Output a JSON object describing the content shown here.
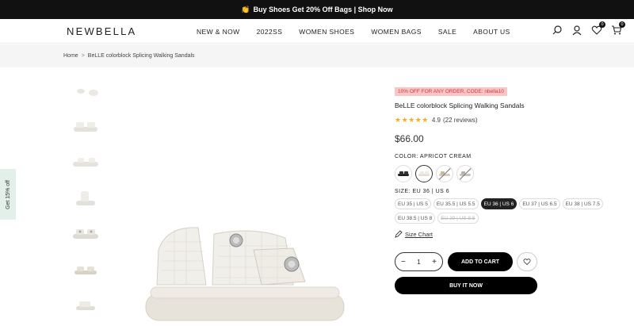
{
  "announcement": {
    "emoji": "👏",
    "text": "Buy Shoes Get 20% Off Bags | Shop Now"
  },
  "header": {
    "logo": "NEWBELLA",
    "nav": [
      "NEW & NOW",
      "2022SS",
      "WOMEN SHOES",
      "WOMEN BAGS",
      "SALE",
      "ABOUT US"
    ],
    "wishlist_count": "0",
    "cart_count": "0"
  },
  "breadcrumb": {
    "home": "Home",
    "separator": ">",
    "current": "BeLLE colorblock Splicing Walking Sandals"
  },
  "side_tab": "Get 15% off",
  "product": {
    "promo": "10% OFF FOR ANY ORDER, CODE: nbella10",
    "title": "BeLLE colorblock Splicing Walking Sandals",
    "stars": "★★★★★",
    "rating": "4.9",
    "reviews": "(22 reviews)",
    "price": "$66.00",
    "color_label": "COLOR:",
    "color_value": "APRICOT CREAM",
    "size_label": "SIZE:",
    "size_value": "EU 36 | US 6",
    "sizes": [
      {
        "label": "EU 35 | US 5",
        "state": "normal"
      },
      {
        "label": "EU 35.5 | US 5.5",
        "state": "normal"
      },
      {
        "label": "EU 36 | US 6",
        "state": "selected"
      },
      {
        "label": "EU 37 | US 6.5",
        "state": "normal"
      },
      {
        "label": "EU 38 | US 7.5",
        "state": "normal"
      },
      {
        "label": "EU 38.5 | US 8",
        "state": "normal"
      },
      {
        "label": "EU 39 | US 8.5",
        "state": "soldout"
      }
    ],
    "size_chart": "Size Chart",
    "quantity": "1",
    "minus": "−",
    "plus": "+",
    "add_to_cart": "ADD TO CART",
    "buy_now": "BUY IT NOW"
  },
  "colors": {
    "accent": "#111111",
    "promo_bg": "#f7c6c6",
    "promo_text": "#dd3333",
    "star": "#f2b01e",
    "side_tab_bg": "#e3efe9"
  }
}
